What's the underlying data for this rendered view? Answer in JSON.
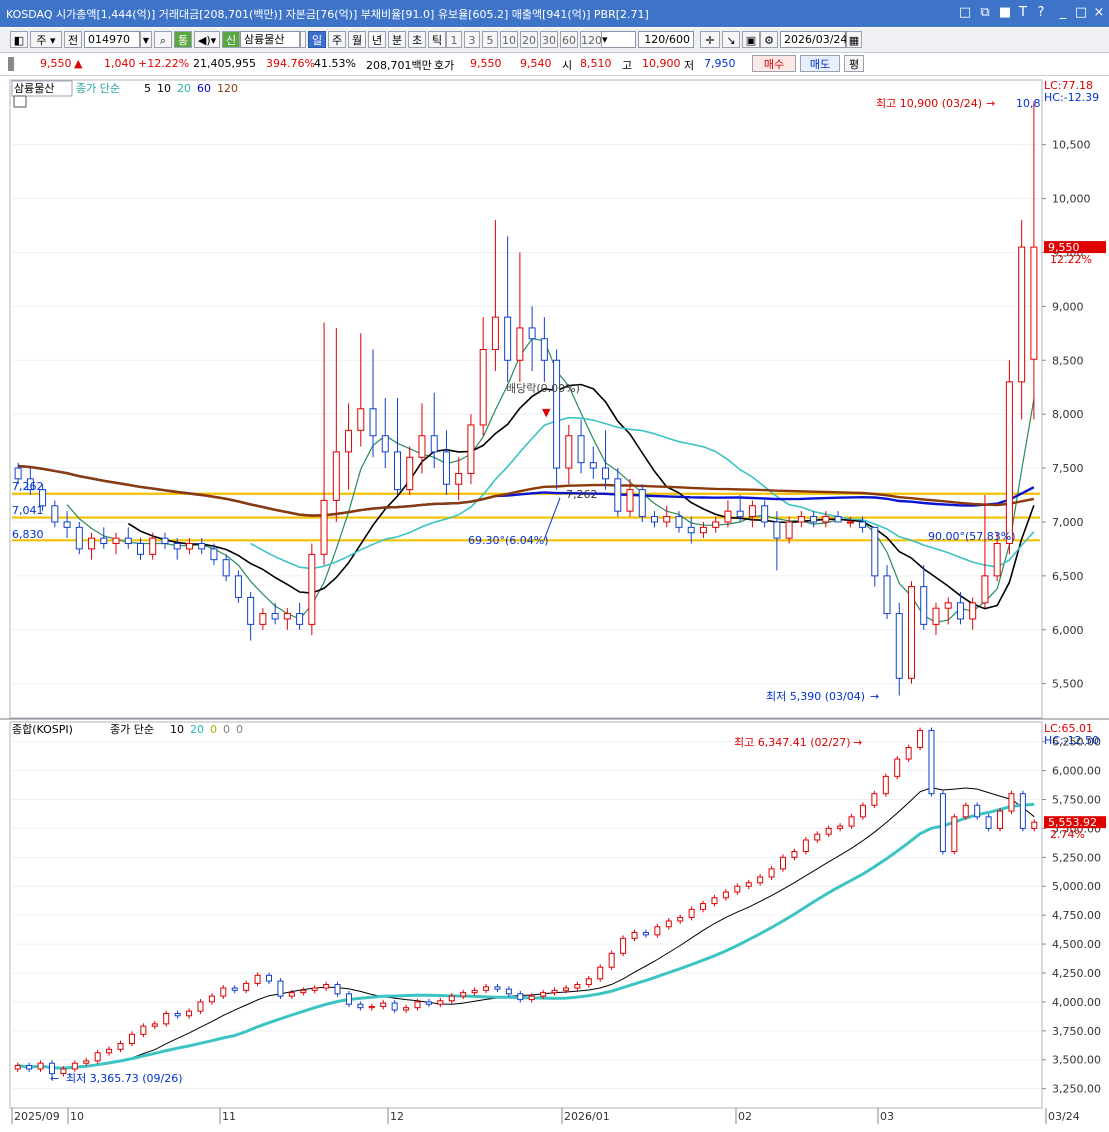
{
  "title_bar": {
    "text": "KOSDAQ 시가총액[1,444(억)] 거래대금[208,701(백만)] 자본금[76(억)] 부채비율[91.0] 유보율[605.2] 매출액[941(억)] PBR[2.71]",
    "controls": [
      "□",
      "⧉",
      "■",
      "T",
      "?",
      "_",
      "□",
      "×"
    ]
  },
  "toolbar": {
    "market": "주",
    "prev": "전",
    "code": "014970",
    "tong": "통",
    "shin": "신",
    "stock_name": "삼륭물산",
    "periods": [
      "일",
      "주",
      "월",
      "년",
      "분",
      "초",
      "틱"
    ],
    "active_period": "일",
    "intervals": [
      "1",
      "3",
      "5",
      "10",
      "20",
      "30",
      "60",
      "120"
    ],
    "count": "120/600",
    "date": "2026/03/24"
  },
  "quote": {
    "price": "9,550",
    "arrow": "▲",
    "change": "1,040",
    "change_pct": "+12.22%",
    "volume": "21,405,955",
    "vol_ratio": "394.76%",
    "turnover": "41.53%",
    "amount": "208,701백만",
    "hoga_label": "호가",
    "ask": "9,550",
    "bid": "9,540",
    "open_label": "시",
    "open": "8,510",
    "high_label": "고",
    "high": "10,900",
    "low_label": "저",
    "low": "7,950",
    "buy": "매수",
    "sell": "매도",
    "eval": "평"
  },
  "chart_data": [
    {
      "type": "candlestick",
      "name": "삼륭물산",
      "legend": {
        "label": "종가 단순",
        "periods": [
          "5",
          "10",
          "20",
          "60",
          "120"
        ],
        "colors": [
          "#000000",
          "#000000",
          "#28b4b4",
          "#0000cc",
          "#8b3a0a"
        ]
      },
      "y_ticks": [
        "10,500",
        "10,000",
        "9,500",
        "9,000",
        "8,500",
        "8,000",
        "7,500",
        "7,000",
        "6,500",
        "6,000",
        "5,500"
      ],
      "ylim": [
        5200,
        11100
      ],
      "lc_label": "LC:77.18",
      "hc_label": "HC:-12.39",
      "last_price": "9,550",
      "last_pct": "12.22%",
      "high_annotation": "최고 10,900 (03/24)",
      "high_right": "10,8",
      "low_annotation": "최저 5,390 (03/04)",
      "dividend_label": "배당락(0.00%)",
      "left_labels": [
        "7,262",
        "7,041",
        "6,830"
      ],
      "mid_label": "7,262",
      "fib_label_1": "69.30°(6.04%)",
      "fib_label_2": "90.00°(57.83%)",
      "h_lines": [
        7262,
        7041,
        6830
      ],
      "candles": [
        [
          7500,
          7550,
          7350,
          7400
        ],
        [
          7400,
          7500,
          7250,
          7300
        ],
        [
          7300,
          7350,
          7100,
          7150
        ],
        [
          7150,
          7200,
          6950,
          7000
        ],
        [
          7000,
          7100,
          6850,
          6950
        ],
        [
          6950,
          7000,
          6700,
          6750
        ],
        [
          6750,
          6900,
          6650,
          6850
        ],
        [
          6850,
          6950,
          6750,
          6800
        ],
        [
          6800,
          6900,
          6700,
          6850
        ],
        [
          6850,
          6950,
          6750,
          6800
        ],
        [
          6800,
          6850,
          6650,
          6700
        ],
        [
          6700,
          6900,
          6650,
          6850
        ],
        [
          6850,
          6900,
          6750,
          6800
        ],
        [
          6800,
          6850,
          6650,
          6750
        ],
        [
          6750,
          6850,
          6700,
          6800
        ],
        [
          6800,
          6850,
          6700,
          6750
        ],
        [
          6750,
          6800,
          6600,
          6650
        ],
        [
          6650,
          6700,
          6450,
          6500
        ],
        [
          6500,
          6550,
          6250,
          6300
        ],
        [
          6300,
          6350,
          5900,
          6050
        ],
        [
          6050,
          6200,
          6000,
          6150
        ],
        [
          6150,
          6250,
          6050,
          6100
        ],
        [
          6100,
          6200,
          6000,
          6150
        ],
        [
          6150,
          6250,
          6000,
          6050
        ],
        [
          6050,
          6800,
          5950,
          6700
        ],
        [
          6700,
          8850,
          6600,
          7200
        ],
        [
          7200,
          8800,
          7000,
          7650
        ],
        [
          7650,
          8100,
          7300,
          7850
        ],
        [
          7850,
          8750,
          7700,
          8050
        ],
        [
          8050,
          8600,
          7600,
          7800
        ],
        [
          7800,
          8150,
          7500,
          7650
        ],
        [
          7650,
          8150,
          7250,
          7300
        ],
        [
          7300,
          7700,
          7250,
          7600
        ],
        [
          7600,
          8100,
          7450,
          7800
        ],
        [
          7800,
          8200,
          7500,
          7650
        ],
        [
          7650,
          7850,
          7250,
          7350
        ],
        [
          7350,
          7600,
          7200,
          7450
        ],
        [
          7450,
          8000,
          7350,
          7900
        ],
        [
          7900,
          8900,
          7800,
          8600
        ],
        [
          8600,
          9800,
          8400,
          8900
        ],
        [
          8900,
          9650,
          8300,
          8500
        ],
        [
          8500,
          9500,
          8300,
          8800
        ],
        [
          8800,
          9000,
          8400,
          8700
        ],
        [
          8700,
          8900,
          8300,
          8500
        ],
        [
          8500,
          8600,
          7300,
          7500
        ],
        [
          7500,
          7900,
          7350,
          7800
        ],
        [
          7800,
          7950,
          7450,
          7550
        ],
        [
          7550,
          7700,
          7400,
          7500
        ],
        [
          7500,
          7850,
          7300,
          7400
        ],
        [
          7400,
          7500,
          7050,
          7100
        ],
        [
          7100,
          7400,
          7050,
          7300
        ],
        [
          7300,
          7350,
          7000,
          7050
        ],
        [
          7050,
          7100,
          6950,
          7000
        ],
        [
          7000,
          7150,
          6950,
          7050
        ],
        [
          7050,
          7100,
          6900,
          6950
        ],
        [
          6950,
          7050,
          6800,
          6900
        ],
        [
          6900,
          7000,
          6850,
          6950
        ],
        [
          6950,
          7050,
          6900,
          7000
        ],
        [
          7000,
          7200,
          6950,
          7100
        ],
        [
          7100,
          7250,
          7000,
          7050
        ],
        [
          7050,
          7200,
          6950,
          7150
        ],
        [
          7150,
          7200,
          6950,
          7000
        ],
        [
          7000,
          7100,
          6550,
          6850
        ],
        [
          6850,
          7050,
          6800,
          7000
        ],
        [
          7000,
          7100,
          6950,
          7050
        ],
        [
          7050,
          7100,
          6950,
          7000
        ],
        [
          7000,
          7100,
          6950,
          7050
        ],
        [
          7050,
          7100,
          7000,
          7000
        ],
        [
          7000,
          7050,
          6950,
          7000
        ],
        [
          7000,
          7050,
          6900,
          6950
        ],
        [
          6950,
          6950,
          6400,
          6500
        ],
        [
          6500,
          6600,
          6100,
          6150
        ],
        [
          6150,
          6250,
          5390,
          5550
        ],
        [
          5550,
          6450,
          5500,
          6400
        ],
        [
          6400,
          6600,
          6000,
          6050
        ],
        [
          6050,
          6250,
          5950,
          6200
        ],
        [
          6200,
          6300,
          6050,
          6250
        ],
        [
          6250,
          6350,
          6050,
          6100
        ],
        [
          6100,
          6300,
          6000,
          6250
        ],
        [
          6250,
          7250,
          6200,
          6500
        ],
        [
          6500,
          6900,
          6450,
          6800
        ],
        [
          6800,
          8500,
          6700,
          8300
        ],
        [
          8300,
          9800,
          7950,
          9550
        ],
        [
          8510,
          10900,
          7950,
          9550
        ]
      ]
    },
    {
      "type": "candlestick",
      "name": "종합(KOSPI)",
      "legend": {
        "label": "종가 단순",
        "periods": [
          "10",
          "20",
          "0",
          "0",
          "0"
        ],
        "colors": [
          "#000000",
          "#28b4b4",
          "#b4b400",
          "#808080",
          "#808080"
        ]
      },
      "y_ticks": [
        "6,250.00",
        "6,000.00",
        "5,750.00",
        "5,500.00",
        "5,250.00",
        "5,000.00",
        "4,750.00",
        "4,500.00",
        "4,250.00",
        "4,000.00",
        "3,750.00",
        "3,500.00",
        "3,250.00"
      ],
      "ylim": [
        3100,
        6420
      ],
      "lc_label": "LC:65.01",
      "hc_label": "HC:-12.50",
      "last_price": "5,553.92",
      "last_pct": "2.74%",
      "high_annotation": "최고 6,347.41 (02/27)",
      "low_annotation": "최저 3,365.73 (09/26)",
      "x_labels": [
        "2025/09",
        "10",
        "11",
        "12",
        "2026/01",
        "02",
        "03",
        "03/24"
      ],
      "closes": [
        3450,
        3420,
        3470,
        3380,
        3420,
        3470,
        3490,
        3560,
        3590,
        3640,
        3720,
        3790,
        3810,
        3900,
        3880,
        3920,
        4000,
        4050,
        4120,
        4100,
        4160,
        4230,
        4180,
        4050,
        4080,
        4100,
        4120,
        4150,
        4070,
        3980,
        3950,
        3960,
        3990,
        3930,
        3950,
        4000,
        3980,
        4010,
        4050,
        4080,
        4100,
        4130,
        4110,
        4070,
        4020,
        4050,
        4080,
        4100,
        4120,
        4150,
        4200,
        4300,
        4420,
        4550,
        4600,
        4580,
        4650,
        4700,
        4730,
        4800,
        4850,
        4900,
        4950,
        5000,
        5030,
        5080,
        5150,
        5250,
        5300,
        5400,
        5450,
        5500,
        5520,
        5600,
        5700,
        5800,
        5950,
        6100,
        6200,
        6347,
        5800,
        5300,
        5600,
        5700,
        5600,
        5500,
        5650,
        5800,
        5500,
        5554
      ]
    }
  ]
}
